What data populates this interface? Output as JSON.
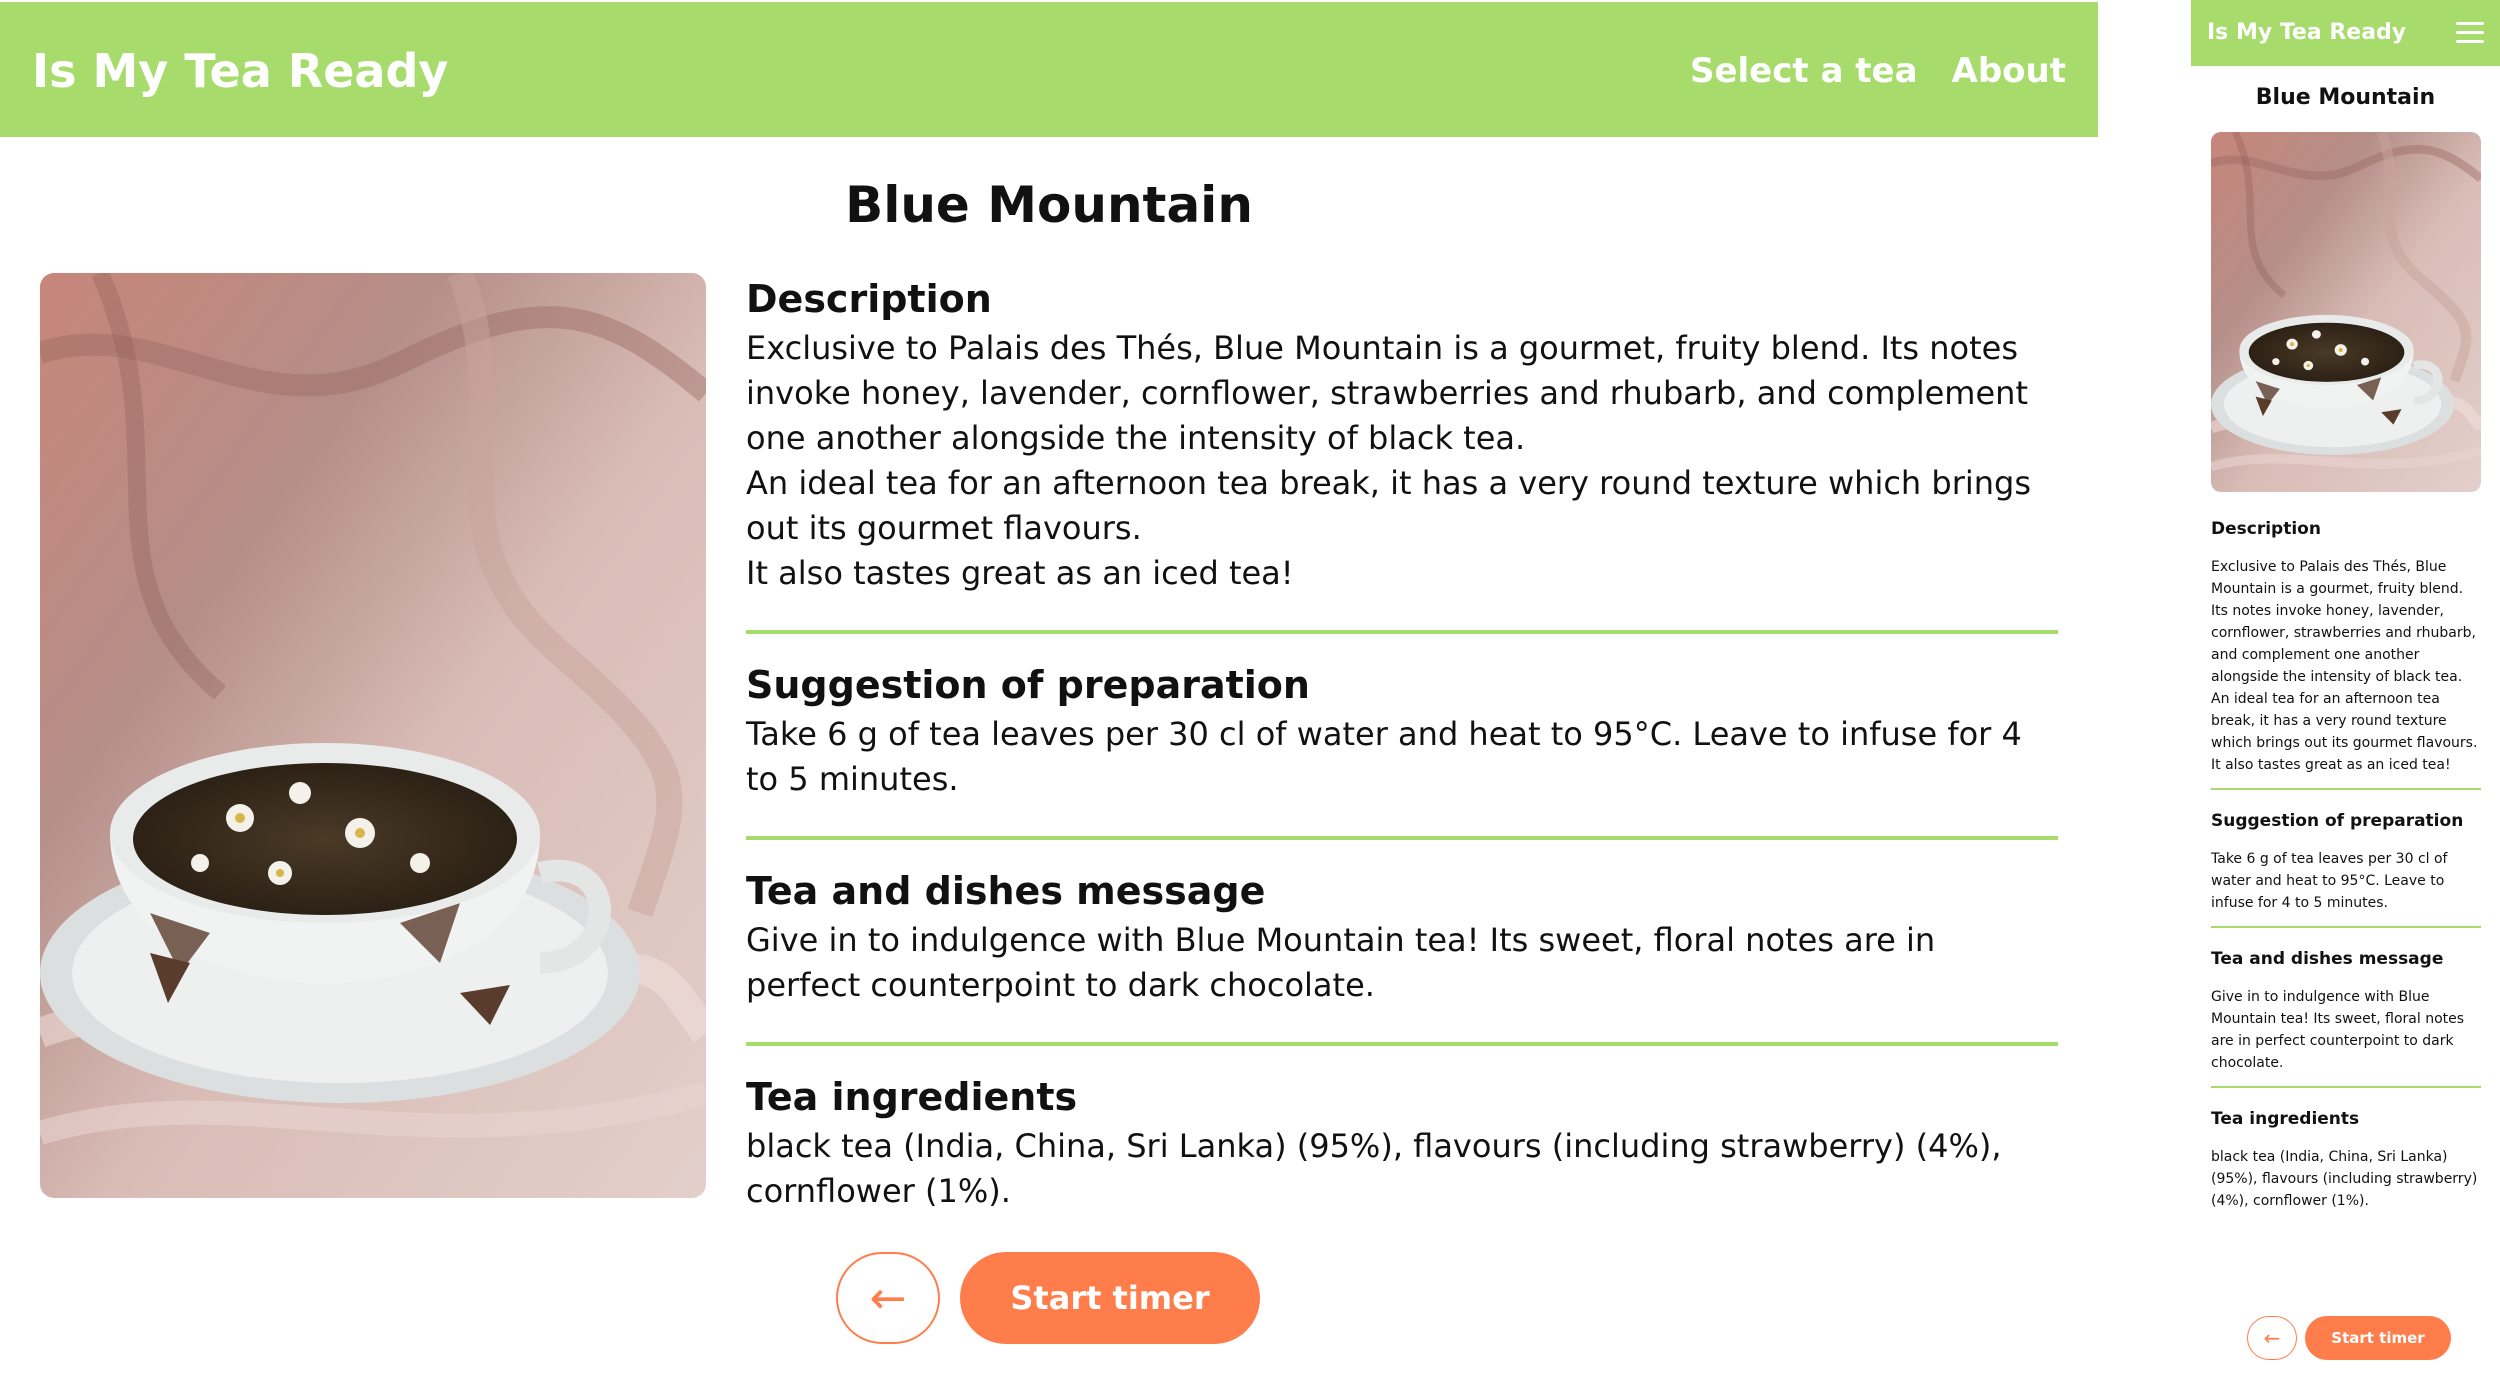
{
  "colors": {
    "accent": "#a7dc6d",
    "button": "#ff7d4a",
    "text": "#111111",
    "background": "#ffffff"
  },
  "app": {
    "name": "Is My Tea Ready",
    "nav": {
      "select_tea": "Select a tea",
      "about": "About"
    }
  },
  "tea": {
    "name": "Blue Mountain",
    "image_icon": "tea-cup-photo",
    "sections": [
      {
        "title": "Description",
        "paragraphs": [
          "Exclusive to Palais des Thés, Blue Mountain is a gourmet, fruity blend. Its notes invoke honey, lavender, cornflower, strawberries and rhubarb, and complement one another alongside the intensity of black tea.",
          "An ideal tea for an afternoon tea break, it has a very round texture which brings out its gourmet flavours.",
          "It also tastes great as an iced tea!"
        ]
      },
      {
        "title": "Suggestion of preparation",
        "paragraphs": [
          "Take 6 g of tea leaves per 30 cl of water and heat to 95°C. Leave to infuse for 4 to 5 minutes."
        ]
      },
      {
        "title": "Tea and dishes message",
        "paragraphs": [
          "Give in to indulgence with Blue Mountain tea! Its sweet, floral notes are in perfect counterpoint to dark chocolate."
        ]
      },
      {
        "title": "Tea ingredients",
        "paragraphs": [
          "black tea (India, China, Sri Lanka) (95%), flavours (including strawberry) (4%), cornflower (1%)."
        ]
      }
    ]
  },
  "actions": {
    "back_symbol": "←",
    "back_icon": "arrow-left-icon",
    "start_timer": "Start timer"
  },
  "mobile": {
    "menu_icon": "hamburger-menu-icon"
  }
}
